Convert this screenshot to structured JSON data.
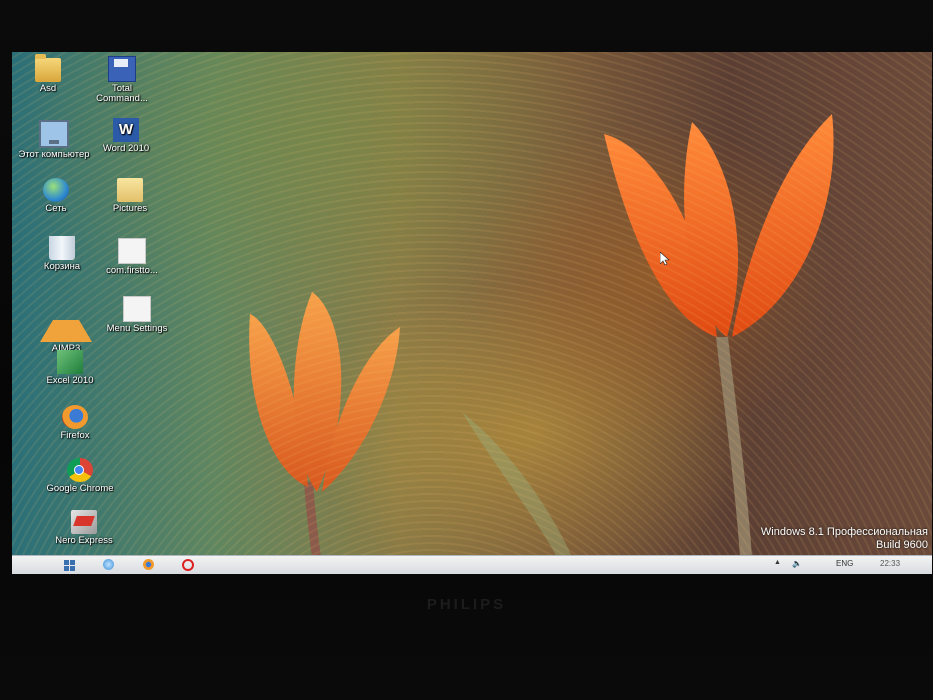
{
  "desktop": {
    "icons": [
      {
        "label": "Asd",
        "icon": "folder-icon"
      },
      {
        "label": "Total Command...",
        "icon": "floppy-disk-icon"
      },
      {
        "label": "Этот компьютер",
        "icon": "computer-icon"
      },
      {
        "label": "Word 2010",
        "icon": "word-icon"
      },
      {
        "label": "Сеть",
        "icon": "network-globe-icon"
      },
      {
        "label": "Pictures",
        "icon": "pictures-folder-icon"
      },
      {
        "label": "Корзина",
        "icon": "recycle-bin-icon"
      },
      {
        "label": "com.firstto...",
        "icon": "file-icon"
      },
      {
        "label": "AIMP3",
        "icon": "aimp-icon"
      },
      {
        "label": "Menu Settings",
        "icon": "file-icon"
      },
      {
        "label": "Excel 2010",
        "icon": "excel-icon"
      },
      {
        "label": "Firefox",
        "icon": "firefox-icon"
      },
      {
        "label": "Google Chrome",
        "icon": "chrome-icon"
      },
      {
        "label": "Nero Express",
        "icon": "nero-icon"
      }
    ]
  },
  "watermark": {
    "line1": "Windows 8.1 Профессиональная",
    "line2": "Build 9600"
  },
  "taskbar": {
    "language": "ENG",
    "time": "22:33"
  },
  "monitor": {
    "brand": "PHILIPS"
  },
  "colors": {
    "taskbar": "#e6e8eb",
    "tulip": "#f26a1f",
    "bezel": "#050505"
  }
}
